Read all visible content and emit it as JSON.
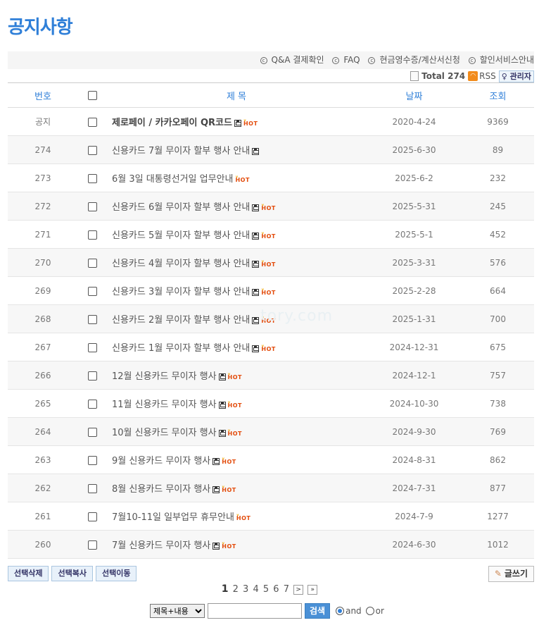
{
  "page_title": "공지사항",
  "top_links": [
    "Q&A 결제확인",
    "FAQ",
    "현금영수증/계산서신청",
    "할인서비스안내"
  ],
  "total_label": "Total 274",
  "rss_label": "RSS",
  "admin_label": "관리자",
  "columns": {
    "num": "번호",
    "subject": "제 목",
    "date": "날짜",
    "hit": "조회"
  },
  "rows": [
    {
      "num": "공지",
      "subject": "제로페이 / 카카오페이 QR코드",
      "file": true,
      "hot": true,
      "date": "2020-4-24",
      "hit": "9369",
      "notice": true
    },
    {
      "num": "274",
      "subject": "신용카드 7월 무이자 할부 행사 안내",
      "file": true,
      "hot": false,
      "date": "2025-6-30",
      "hit": "89"
    },
    {
      "num": "273",
      "subject": "6월 3일 대통령선거일 업무안내",
      "file": false,
      "hot": true,
      "date": "2025-6-2",
      "hit": "232"
    },
    {
      "num": "272",
      "subject": "신용카드 6월 무이자 할부 행사 안내",
      "file": true,
      "hot": true,
      "date": "2025-5-31",
      "hit": "245"
    },
    {
      "num": "271",
      "subject": "신용카드 5월 무이자 할부 행사 안내",
      "file": true,
      "hot": true,
      "date": "2025-5-1",
      "hit": "452"
    },
    {
      "num": "270",
      "subject": "신용카드 4월 무이자 할부 행사 안내",
      "file": true,
      "hot": true,
      "date": "2025-3-31",
      "hit": "576"
    },
    {
      "num": "269",
      "subject": "신용카드 3월 무이자 할부 행사 안내",
      "file": true,
      "hot": true,
      "date": "2025-2-28",
      "hit": "664"
    },
    {
      "num": "268",
      "subject": "신용카드 2월 무이자 할부 행사 안내",
      "file": true,
      "hot": true,
      "date": "2025-1-31",
      "hit": "700"
    },
    {
      "num": "267",
      "subject": "신용카드 1월 무이자 할부 행사 안내",
      "file": true,
      "hot": true,
      "date": "2024-12-31",
      "hit": "675"
    },
    {
      "num": "266",
      "subject": "12월 신용카드 무이자 행사",
      "file": true,
      "hot": true,
      "date": "2024-12-1",
      "hit": "757"
    },
    {
      "num": "265",
      "subject": "11월 신용카드 무이자 행사",
      "file": true,
      "hot": true,
      "date": "2024-10-30",
      "hit": "738"
    },
    {
      "num": "264",
      "subject": "10월 신용카드 무이자 행사",
      "file": true,
      "hot": true,
      "date": "2024-9-30",
      "hit": "769"
    },
    {
      "num": "263",
      "subject": "9월 신용카드 무이자 행사",
      "file": true,
      "hot": true,
      "date": "2024-8-31",
      "hit": "862"
    },
    {
      "num": "262",
      "subject": "8월 신용카드 무이자 행사",
      "file": true,
      "hot": true,
      "date": "2024-7-31",
      "hit": "877"
    },
    {
      "num": "261",
      "subject": "7월10-11일 일부업무 휴무안내",
      "file": false,
      "hot": true,
      "date": "2024-7-9",
      "hit": "1277"
    },
    {
      "num": "260",
      "subject": "7월 신용카드 무이자 행사",
      "file": true,
      "hot": true,
      "date": "2024-6-30",
      "hit": "1012"
    }
  ],
  "hot_label": "HOT",
  "watermark": "tory.com",
  "buttons": {
    "delete": "선택삭제",
    "copy": "선택복사",
    "move": "선택이동",
    "write": "글쓰기"
  },
  "pages": [
    "1",
    "2",
    "3",
    "4",
    "5",
    "6",
    "7"
  ],
  "current_page": "1",
  "search": {
    "select_value": "제목+내용",
    "placeholder": "",
    "button": "검색",
    "and_label": "and",
    "or_label": "or"
  }
}
